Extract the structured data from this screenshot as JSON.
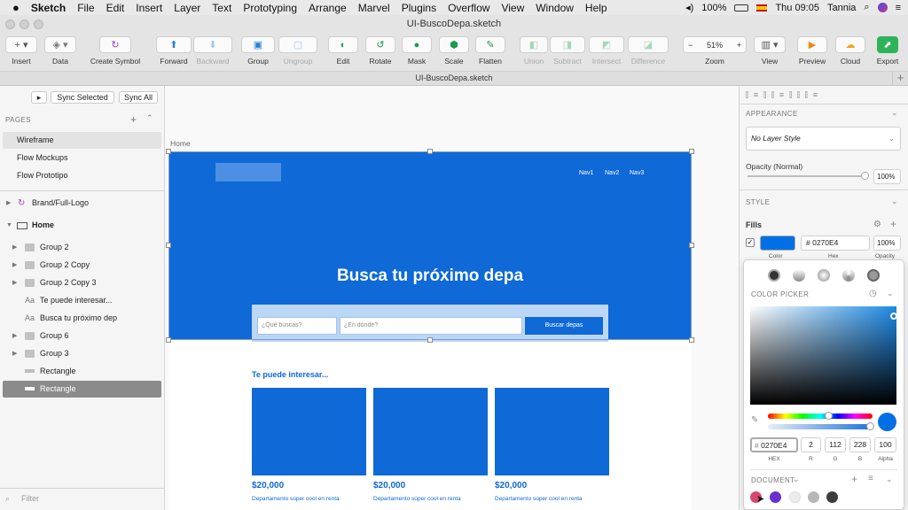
{
  "menubar": {
    "items": [
      "Sketch",
      "File",
      "Edit",
      "Insert",
      "Layer",
      "Text",
      "Prototyping",
      "Arrange",
      "Marvel",
      "Plugins",
      "Overflow",
      "View",
      "Window",
      "Help"
    ],
    "battery": "100%",
    "clock": "Thu 09:05",
    "user": "Tannia"
  },
  "window": {
    "title": "UI-BuscoDepa.sketch",
    "doc_tab": "UI-BuscoDepa.sketch"
  },
  "toolbar": {
    "insert": "Insert",
    "data": "Data",
    "create_symbol": "Create Symbol",
    "forward": "Forward",
    "backward": "Backward",
    "group": "Group",
    "ungroup": "Ungroup",
    "edit": "Edit",
    "rotate": "Rotate",
    "mask": "Mask",
    "scale": "Scale",
    "flatten": "Flatten",
    "union": "Union",
    "subtract": "Subtract",
    "intersect": "Intersect",
    "difference": "Difference",
    "zoom_label": "Zoom",
    "zoom_value": "51%",
    "view": "View",
    "preview": "Preview",
    "cloud": "Cloud",
    "export": "Export"
  },
  "left_panel": {
    "sync_selected": "Sync Selected",
    "sync_all": "Sync All",
    "pages_heading": "PAGES",
    "pages": [
      "Wireframe",
      "Flow Mockups",
      "Flow Prototipo"
    ],
    "symbol_row": "Brand/Full-Logo",
    "artboard_row": "Home",
    "layers": [
      {
        "label": "Group 2",
        "kind": "folder"
      },
      {
        "label": "Group 2 Copy",
        "kind": "folder"
      },
      {
        "label": "Group 2 Copy 3",
        "kind": "folder"
      },
      {
        "label": "Te puede interesar...",
        "kind": "text"
      },
      {
        "label": "Busca tu próximo dep",
        "kind": "text"
      },
      {
        "label": "Group 6",
        "kind": "folder"
      },
      {
        "label": "Group 3",
        "kind": "folder"
      },
      {
        "label": "Rectangle",
        "kind": "rect"
      },
      {
        "label": "Rectangle",
        "kind": "rect"
      }
    ],
    "filter_placeholder": "Filter"
  },
  "canvas": {
    "artboard_label": "Home",
    "nav": [
      "Nav1",
      "Nav2",
      "Nav3"
    ],
    "hero_title": "Busca tu próximo depa",
    "search_what": "¿Qué buscas?",
    "search_where": "¿En dónde?",
    "search_button": "Buscar depas",
    "section_title": "Te puede interesar...",
    "cards": [
      {
        "price": "$20,000",
        "desc": "Departamento súper cool en renta"
      },
      {
        "price": "$20,000",
        "desc": "Departamento súper cool en renta"
      },
      {
        "price": "$20,000",
        "desc": "Departamento súper cool en renta"
      }
    ]
  },
  "inspector": {
    "appearance_heading": "APPEARANCE",
    "layer_style": "No Layer Style",
    "opacity_label": "Opacity (Normal)",
    "opacity_value": "100%",
    "style_heading": "STYLE",
    "fills_label": "Fills",
    "fill_hex": "# 0270E4",
    "fill_opacity": "100%",
    "fill_col_color": "Color",
    "fill_col_hex": "Hex",
    "fill_col_opacity": "Opacity",
    "picker_heading": "COLOR PICKER",
    "hex_value": "0270E4",
    "r": "2",
    "g": "112",
    "b": "228",
    "alpha": "100",
    "lbl_hex": "HEX",
    "lbl_r": "R",
    "lbl_g": "G",
    "lbl_b": "B",
    "lbl_alpha": "Alpha",
    "document_heading": "DOCUMENT"
  },
  "colors": {
    "accent": "#0270E4",
    "swatches": [
      "#d9466f",
      "#6a2fd1",
      "#ececec",
      "#b7b7b7",
      "#3d3d3d"
    ]
  }
}
